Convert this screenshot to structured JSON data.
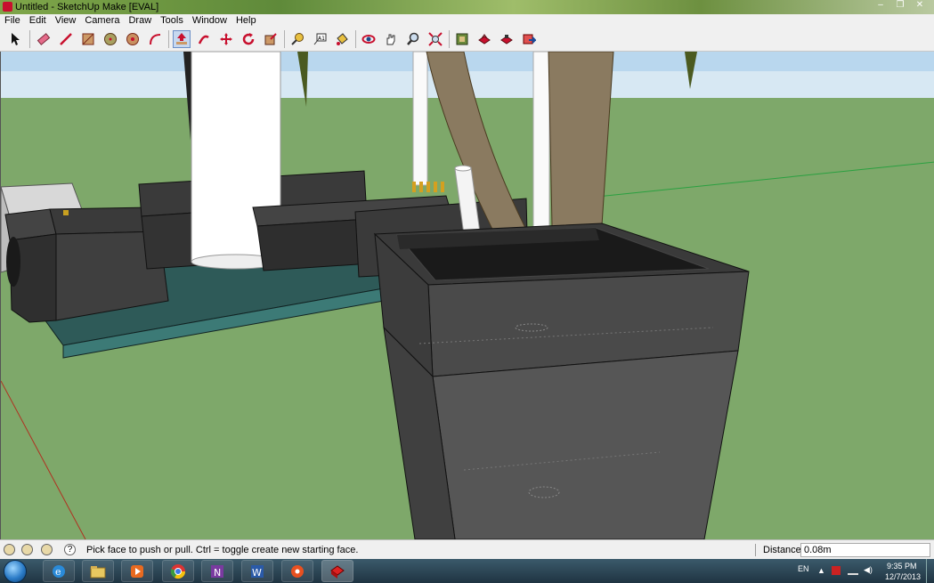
{
  "window": {
    "title": "Untitled - SketchUp Make [EVAL]",
    "controls": [
      "–",
      "❐",
      "✕"
    ]
  },
  "menu": [
    "File",
    "Edit",
    "View",
    "Camera",
    "Draw",
    "Tools",
    "Window",
    "Help"
  ],
  "toolbar": {
    "tools": [
      {
        "name": "select-tool-icon",
        "active": false
      },
      {
        "name": "eraser-tool-icon",
        "active": false
      },
      {
        "name": "line-tool-icon",
        "active": false
      },
      {
        "name": "rectangle-tool-icon",
        "active": false
      },
      {
        "name": "circle-tool-icon",
        "active": false
      },
      {
        "name": "polygon-tool-icon",
        "active": false
      },
      {
        "name": "arc-tool-icon",
        "active": false
      },
      {
        "name": "push-pull-tool-icon",
        "active": true
      },
      {
        "name": "follow-me-tool-icon",
        "active": false
      },
      {
        "name": "move-tool-icon",
        "active": false
      },
      {
        "name": "rotate-tool-icon",
        "active": false
      },
      {
        "name": "scale-tool-icon",
        "active": false
      },
      {
        "name": "tape-measure-tool-icon",
        "active": false
      },
      {
        "name": "text-tool-icon",
        "active": false
      },
      {
        "name": "paint-bucket-tool-icon",
        "active": false
      },
      {
        "name": "orbit-tool-icon",
        "active": false
      },
      {
        "name": "pan-tool-icon",
        "active": false
      },
      {
        "name": "zoom-tool-icon",
        "active": false
      },
      {
        "name": "zoom-extents-tool-icon",
        "active": false
      },
      {
        "name": "warehouse-icon",
        "active": false
      },
      {
        "name": "share-model-icon",
        "active": false
      },
      {
        "name": "extension-warehouse-icon",
        "active": false
      },
      {
        "name": "send-to-layout-icon",
        "active": false
      }
    ]
  },
  "status": {
    "hint": "Pick face to push or pull.  Ctrl = toggle create new starting face.",
    "distance_label": "Distance",
    "distance_value": "0.08m"
  },
  "taskbar": {
    "apps": [
      "internet-explorer-icon",
      "file-explorer-icon",
      "media-player-icon",
      "chrome-icon",
      "onenote-icon",
      "word-icon",
      "app-orange-icon",
      "sketchup-icon"
    ],
    "lang": "EN",
    "time": "9:35 PM",
    "date": "12/7/2013"
  },
  "colors": {
    "ground": "#7ea86a",
    "sky": "#cfe3f2",
    "dark_block": "#3a3a3a",
    "pipe": "#8a7a60",
    "board": "#2e5a58"
  }
}
